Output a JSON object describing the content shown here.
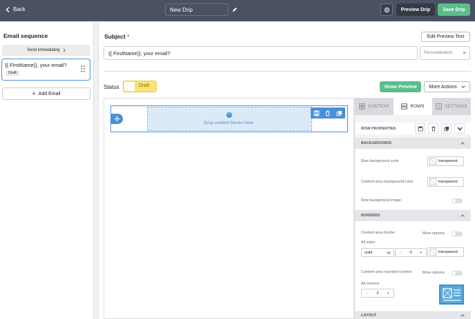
{
  "topbar": {
    "back_label": "Back",
    "drip_name": "New Drip",
    "preview_label": "Preview Drip",
    "save_label": "Save Drip"
  },
  "sidebar": {
    "title": "Email sequence",
    "send_timing": "Send Immediately",
    "emails": [
      {
        "subject": "{{.FirstName}}, your email?",
        "status": "Draft"
      }
    ],
    "add_label": "Add Email"
  },
  "editor": {
    "subject_label": "Subject",
    "required_mark": "*",
    "edit_preview_label": "Edit Preview Text",
    "subject_value": "{{.FirstName}}, your email?",
    "personalization_placeholder": "Personalization",
    "status_label": "Status",
    "status_value": "Draft",
    "show_preview_label": "Show Preview",
    "more_actions_label": "More Actions"
  },
  "canvas": {
    "drop_text": "Drop content blocks here"
  },
  "panel": {
    "tabs": [
      {
        "label": "CONTENT"
      },
      {
        "label": "ROWS"
      },
      {
        "label": "SETTINGS"
      }
    ],
    "row_properties": "ROW PROPERTIES",
    "backgrounds": {
      "header": "BACKGROUNDS",
      "row_bg_label": "Row background color",
      "row_bg_value": "transparent",
      "content_bg_label": "Content area background color",
      "content_bg_value": "transparent",
      "row_bg_image_label": "Row background image"
    },
    "borders": {
      "header": "BORDERS",
      "content_border_label": "Content area border",
      "more_options": "More options",
      "all_sides": "All sides",
      "style_value": "solid",
      "minus": "-",
      "width_value": "0",
      "plus": "+",
      "color_value": "transparent",
      "rounded_label": "Content area rounded corners",
      "more_options_2": "More options",
      "all_corners": "All corners",
      "radius_value": "0"
    },
    "layout": {
      "header": "LAYOUT"
    }
  },
  "colors": {
    "topbar": "#4a5163",
    "accent_green": "#5bbd8a",
    "accent_blue": "#4a90d9",
    "draft_yellow": "#fbe37a"
  }
}
